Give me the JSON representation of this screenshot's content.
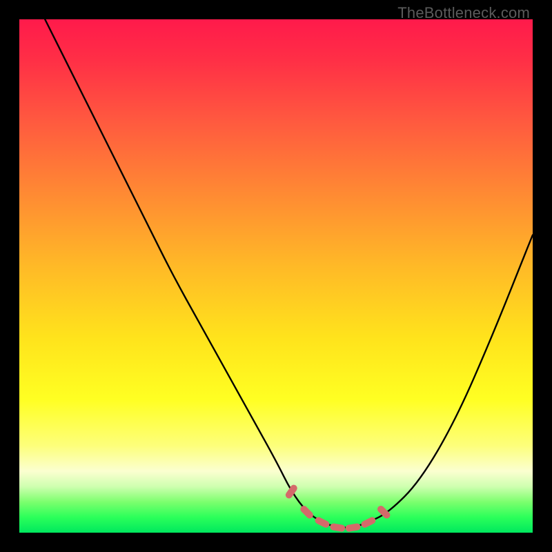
{
  "watermark": "TheBottleneck.com",
  "colors": {
    "page_bg": "#000000",
    "curve": "#000000",
    "accent_marks": "#d46a6a",
    "gradient_top": "#ff1a4b",
    "gradient_bottom": "#00e85e"
  },
  "chart_data": {
    "type": "line",
    "title": "",
    "xlabel": "",
    "ylabel": "",
    "xlim": [
      0,
      100
    ],
    "ylim": [
      0,
      100
    ],
    "series": [
      {
        "name": "bottleneck-curve",
        "x": [
          5,
          10,
          15,
          20,
          25,
          30,
          35,
          40,
          45,
          50,
          53,
          56,
          59,
          62,
          65,
          68,
          72,
          78,
          85,
          92,
          100
        ],
        "values": [
          100,
          90,
          80,
          70,
          60,
          50,
          41,
          32,
          23,
          14,
          8,
          4,
          2,
          1,
          1,
          2,
          4,
          10,
          22,
          38,
          58
        ]
      }
    ],
    "accent_segment": {
      "name": "optimal-range-marks",
      "x": [
        53,
        56,
        59,
        62,
        65,
        68,
        71
      ],
      "values": [
        8,
        4,
        2,
        1,
        1,
        2,
        4
      ]
    }
  }
}
